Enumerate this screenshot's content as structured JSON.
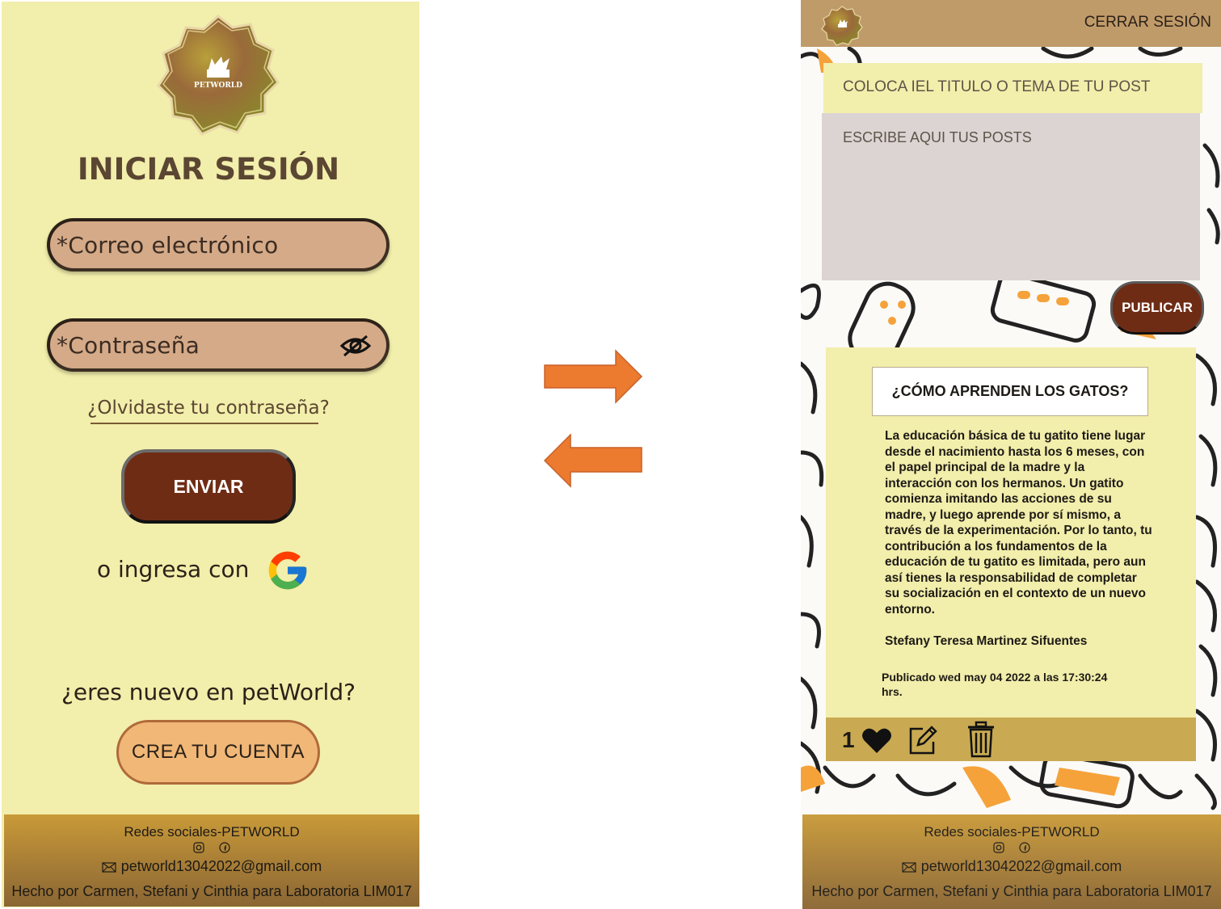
{
  "login": {
    "brand": "PETWORLD",
    "title": "INICIAR SESIÓN",
    "email_placeholder": "*Correo electrónico",
    "password_placeholder": "*Contraseña",
    "forgot_link": "¿Olvidaste tu contraseña?",
    "submit_label": "ENVIAR",
    "alt_login_text": "o ingresa con",
    "new_user_text": "¿eres nuevo en petWorld?",
    "create_account_label": "CREA TU CUENTA"
  },
  "footer": {
    "social_title": "Redes sociales-PETWORLD",
    "email": "petworld13042022@gmail.com",
    "credits": "Hecho por Carmen, Stefani y Cinthia para Laboratoria LIM017"
  },
  "feed": {
    "logout_label": "CERRAR SESIÓN",
    "title_placeholder": "COLOCA IEL TITULO O  TEMA DE TU POST",
    "post_placeholder": "ESCRIBE AQUI TUS POSTS",
    "publish_label": "PUBLICAR",
    "post": {
      "title": "¿CÓMO APRENDEN LOS GATOS?",
      "body": "La educación básica de tu gatito tiene lugar desde el nacimiento hasta los 6 meses, con el papel principal de la madre y la interacción con los hermanos. Un gatito comienza imitando las acciones de su madre, y luego aprende por sí mismo, a través de la experimentación. Por lo tanto, tu contribución a los fundamentos de la educación de tu gatito es limitada, pero aun así tienes la responsabilidad de completar su socialización en el contexto de un nuevo entorno.",
      "author": "Stefany Teresa Martinez Sifuentes",
      "published": "Publicado  wed may  04 2022 a las 17:30:24 hrs.",
      "likes": "1"
    }
  },
  "colors": {
    "login_bg": "#f2eeab",
    "brown_button": "#6f2c14",
    "input_fill": "#d5aa88",
    "arrow": "#ec7a2f",
    "footer_gold": "#c99a38",
    "action_bar": "#c9aa52"
  },
  "icons": [
    "eye-off-icon",
    "google-icon",
    "instagram-icon",
    "facebook-icon",
    "mail-icon",
    "heart-icon",
    "edit-icon",
    "trash-icon",
    "arrow-right-icon",
    "arrow-left-icon"
  ]
}
